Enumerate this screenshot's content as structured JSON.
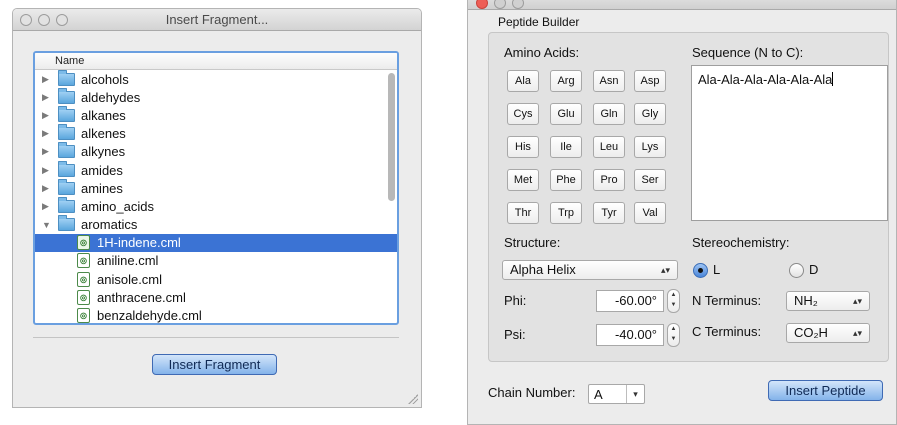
{
  "fragment_window": {
    "title": "Insert Fragment...",
    "column_header": "Name",
    "items": [
      {
        "type": "folder",
        "label": "alcohols",
        "expanded": false
      },
      {
        "type": "folder",
        "label": "aldehydes",
        "expanded": false
      },
      {
        "type": "folder",
        "label": "alkanes",
        "expanded": false
      },
      {
        "type": "folder",
        "label": "alkenes",
        "expanded": false
      },
      {
        "type": "folder",
        "label": "alkynes",
        "expanded": false
      },
      {
        "type": "folder",
        "label": "amides",
        "expanded": false
      },
      {
        "type": "folder",
        "label": "amines",
        "expanded": false
      },
      {
        "type": "folder",
        "label": "amino_acids",
        "expanded": false
      },
      {
        "type": "folder",
        "label": "aromatics",
        "expanded": true
      },
      {
        "type": "file",
        "label": "1H-indene.cml",
        "selected": true
      },
      {
        "type": "file",
        "label": "aniline.cml"
      },
      {
        "type": "file",
        "label": "anisole.cml"
      },
      {
        "type": "file",
        "label": "anthracene.cml"
      },
      {
        "type": "file",
        "label": "benzaldehyde.cml"
      }
    ],
    "insert_button": "Insert Fragment"
  },
  "peptide_window": {
    "group_title": "Peptide Builder",
    "amino_acids_label": "Amino Acids:",
    "amino_acids": [
      [
        "Ala",
        "Arg",
        "Asn",
        "Asp"
      ],
      [
        "Cys",
        "Glu",
        "Gln",
        "Gly"
      ],
      [
        "His",
        "Ile",
        "Leu",
        "Lys"
      ],
      [
        "Met",
        "Phe",
        "Pro",
        "Ser"
      ],
      [
        "Thr",
        "Trp",
        "Tyr",
        "Val"
      ]
    ],
    "sequence_label": "Sequence (N to C):",
    "sequence_value": "Ala-Ala-Ala-Ala-Ala-Ala",
    "structure_label": "Structure:",
    "structure_value": "Alpha Helix",
    "stereo_label": "Stereochemistry:",
    "stereo_l": "L",
    "stereo_d": "D",
    "phi_label": "Phi:",
    "phi_value": "-60.00°",
    "psi_label": "Psi:",
    "psi_value": "-40.00°",
    "n_terminus_label": "N Terminus:",
    "n_terminus_value": "NH₂",
    "c_terminus_label": "C Terminus:",
    "c_terminus_value": "CO₂H",
    "chain_label": "Chain Number:",
    "chain_value": "A",
    "insert_button": "Insert Peptide"
  }
}
